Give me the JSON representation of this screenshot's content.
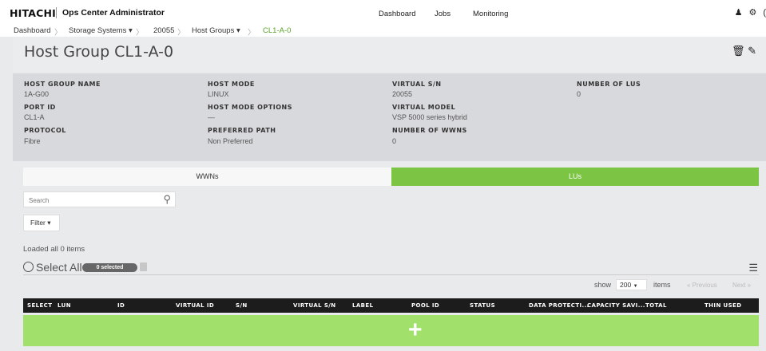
{
  "topbar": {
    "brand": "HITACHI",
    "app_name": "Ops Center Administrator",
    "nav": [
      "Dashboard",
      "Jobs",
      "Monitoring"
    ],
    "icons": [
      "user-icon",
      "gear-icon",
      "help-icon"
    ]
  },
  "breadcrumb": {
    "items": [
      "Dashboard",
      "Storage Systems ▾",
      "20055",
      "Host Groups ▾",
      "CL1-A-0"
    ],
    "separator": "〉"
  },
  "header": {
    "title": "Host Group CL1-A-0",
    "icons": [
      "trash-icon",
      "pencil-icon"
    ]
  },
  "properties": [
    {
      "label": "HOST GROUP NAME",
      "value": "1A-G00"
    },
    {
      "label": "PORT ID",
      "value": "CL1-A"
    },
    {
      "label": "PROTOCOL",
      "value": "Fibre"
    },
    {
      "label": "HOST MODE",
      "value": "LINUX"
    },
    {
      "label": "HOST MODE OPTIONS",
      "value": "—"
    },
    {
      "label": "PREFERRED PATH",
      "value": "Non Preferred"
    },
    {
      "label": "VIRTUAL S/N",
      "value": "20055"
    },
    {
      "label": "VIRTUAL MODEL",
      "value": "VSP 5000 series hybrid"
    },
    {
      "label": "NUMBER OF WWNS",
      "value": "0"
    },
    {
      "label": "NUMBER OF LUS",
      "value": "0"
    }
  ],
  "tabs": [
    {
      "label": "WWNs",
      "active": false
    },
    {
      "label": "LUs",
      "active": true
    }
  ],
  "search": {
    "placeholder": "Search"
  },
  "filter": {
    "label": "Filter ▾"
  },
  "list": {
    "loaded_text": "Loaded all 0 items",
    "select_all_label": "Select All",
    "selected_badge": "0 selected",
    "show_label": "show",
    "page_size": "200",
    "items_label": "items",
    "previous_label": "« Previous",
    "next_label": "Next »"
  },
  "table": {
    "columns": [
      "SELECT",
      "LUN",
      "ID",
      "VIRTUAL ID",
      "S/N",
      "VIRTUAL S/N",
      "LABEL",
      "POOL ID",
      "STATUS",
      "DATA PROTECTI...",
      "CAPACITY SAVI...",
      "TOTAL",
      "THIN USED"
    ],
    "add_button": "+"
  },
  "colors": {
    "accent_green": "#7cc443",
    "add_row_green": "#a1e06b",
    "breadcrumb_current": "#5aa127",
    "table_header": "#1c1c1c"
  }
}
